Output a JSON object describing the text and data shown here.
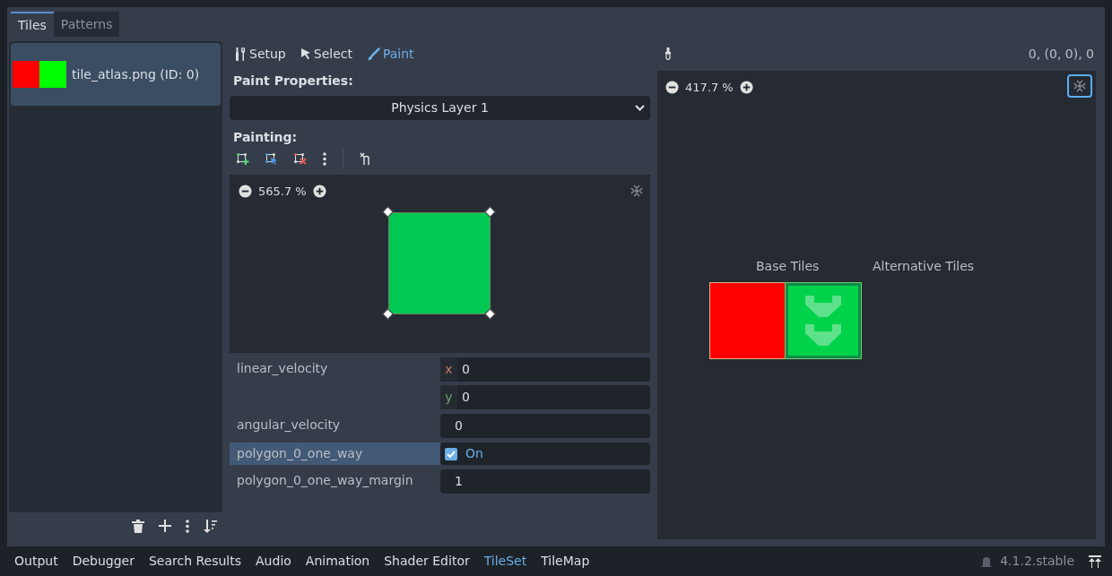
{
  "tabs": [
    {
      "label": "Tiles",
      "selected": true
    },
    {
      "label": "Patterns",
      "selected": false
    }
  ],
  "sources": [
    {
      "name": "tile_atlas.png (ID: 0)",
      "selected": true
    }
  ],
  "modes": [
    {
      "label": "Setup",
      "kind": "setup",
      "selected": false
    },
    {
      "label": "Select",
      "kind": "select",
      "selected": false
    },
    {
      "label": "Paint",
      "kind": "paint",
      "selected": true
    }
  ],
  "paint_properties": {
    "heading": "Paint Properties:",
    "layer": "Physics Layer 1"
  },
  "painting": {
    "heading": "Painting:",
    "zoom": "565.7 %"
  },
  "properties": [
    {
      "name": "linear_velocity",
      "kind": "vector",
      "selected": false,
      "components": [
        {
          "axis": "x",
          "value": "0",
          "color": "#c47a6a"
        },
        {
          "axis": "y",
          "value": "0",
          "color": "#6aa36a"
        }
      ]
    },
    {
      "name": "angular_velocity",
      "kind": "number",
      "selected": false,
      "value": "0"
    },
    {
      "name": "polygon_0_one_way",
      "kind": "checkbox",
      "selected": true,
      "checked": true,
      "value": "On"
    },
    {
      "name": "polygon_0_one_way_margin",
      "kind": "number",
      "selected": false,
      "value": "1"
    }
  ],
  "atlas": {
    "coords": "0, (0, 0), 0",
    "zoom": "417.7 %",
    "base_label": "Base Tiles",
    "alt_label": "Alternative Tiles"
  },
  "bottom_tabs": [
    {
      "label": "Output",
      "selected": false
    },
    {
      "label": "Debugger",
      "selected": false
    },
    {
      "label": "Search Results",
      "selected": false
    },
    {
      "label": "Audio",
      "selected": false
    },
    {
      "label": "Animation",
      "selected": false
    },
    {
      "label": "Shader Editor",
      "selected": false
    },
    {
      "label": "TileSet",
      "selected": true
    },
    {
      "label": "TileMap",
      "selected": false
    }
  ],
  "version": "4.1.2.stable"
}
